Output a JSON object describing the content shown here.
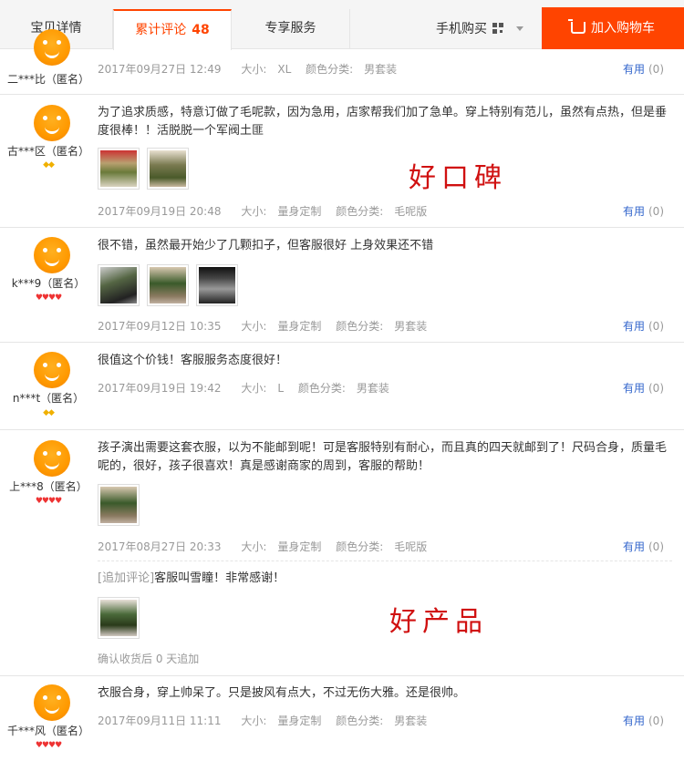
{
  "tabs": {
    "details": "宝贝详情",
    "reviews": "累计评论",
    "reviews_count": "48",
    "service": "专享服务",
    "mobile_buy": "手机购买",
    "add_to_cart": "加入购物车"
  },
  "labels": {
    "size": "大小:",
    "color": "颜色分类:",
    "useful": "有用",
    "append_tag": "[追加评论]"
  },
  "reviews": [
    {
      "user": "二***比（匿名）",
      "date": "2017年09月27日 12:49",
      "size": "XL",
      "color": "男套装",
      "useful_count": "(0)"
    },
    {
      "user": "古***区（匿名）",
      "text": "为了追求质感，特意订做了毛呢款，因为急用，店家帮我们加了急单。穿上特别有范儿，虽然有点热，但是垂度很棒！！活脱脱一个军阀土匪",
      "date": "2017年09月19日 20:48",
      "size": "量身定制",
      "color": "毛呢版",
      "useful_count": "(0)",
      "badge": "◆◆"
    },
    {
      "user": "k***9（匿名）",
      "text": "很不错，虽然最开始少了几颗扣子，但客服很好 上身效果还不错",
      "date": "2017年09月12日 10:35",
      "size": "量身定制",
      "color": "男套装",
      "useful_count": "(0)",
      "badge": "♥♥♥♥"
    },
    {
      "user": "n***t（匿名）",
      "text": "很值这个价钱！客服服务态度很好！",
      "date": "2017年09月19日 19:42",
      "size": "L",
      "color": "男套装",
      "useful_count": "(0)",
      "badge": "◆◆"
    },
    {
      "user": "上***8（匿名）",
      "text": "孩子演出需要这套衣服，以为不能邮到呢！可是客服特别有耐心，而且真的四天就邮到了！尺码合身，质量毛呢的，很好，孩子很喜欢！真是感谢商家的周到，客服的帮助！",
      "date": "2017年08月27日 20:33",
      "size": "量身定制",
      "color": "毛呢版",
      "useful_count": "(0)",
      "badge": "♥♥♥♥",
      "append_text": "客服叫雪瞳！非常感谢！",
      "append_confirm": "确认收货后 0 天追加"
    },
    {
      "user": "千***风（匿名）",
      "text": "衣服合身，穿上帅呆了。只是披风有点大，不过无伤大雅。还是很帅。",
      "date": "2017年09月11日 11:11",
      "size": "量身定制",
      "color": "男套装",
      "useful_count": "(0)",
      "badge": "♥♥♥♥"
    }
  ],
  "stamps": {
    "reputation": "好口碑",
    "good_product": "好产品"
  },
  "colors": {
    "accent": "#ff4400",
    "stamp": "#d01010",
    "useful_link": "#3366cc"
  }
}
